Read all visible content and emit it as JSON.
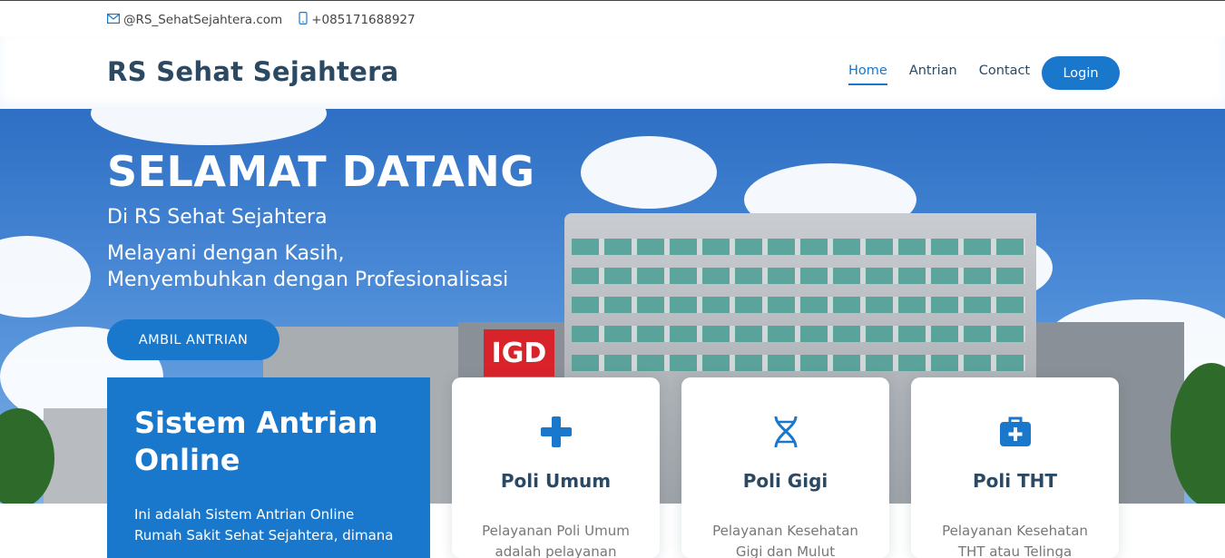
{
  "topbar": {
    "email": "@RS_SehatSejahtera.com",
    "phone": "+085171688927",
    "email_icon": "envelope-icon",
    "phone_icon": "phone-icon"
  },
  "header": {
    "logo": "RS Sehat Sejahtera",
    "nav": [
      "Home",
      "Antrian",
      "Contact"
    ],
    "login_label": "Login"
  },
  "hero": {
    "title": "SELAMAT DATANG",
    "subtitle": "Di RS Sehat Sejahtera",
    "tagline_1": "Melayani dengan Kasih,",
    "tagline_2": "Menyembuhkan dengan Profesionalisasi",
    "cta_label": "AMBIL ANTRIAN",
    "sign_text": "IGD"
  },
  "info_box": {
    "title": "Sistem Antrian Online",
    "text": "Ini adalah Sistem Antrian Online Rumah Sakit Sehat Sejahtera, dimana"
  },
  "cards": [
    {
      "title": "Poli Umum",
      "text": "Pelayanan Poli Umum adalah pelayanan",
      "icon": "plus-icon"
    },
    {
      "title": "Poli Gigi",
      "text": "Pelayanan Kesehatan Gigi dan Mulut",
      "icon": "dna-icon"
    },
    {
      "title": "Poli THT",
      "text": "Pelayanan Kesehatan THT atau Telinga",
      "icon": "medkit-icon"
    }
  ],
  "colors": {
    "accent": "#1977cc",
    "heading": "#2c4964"
  }
}
